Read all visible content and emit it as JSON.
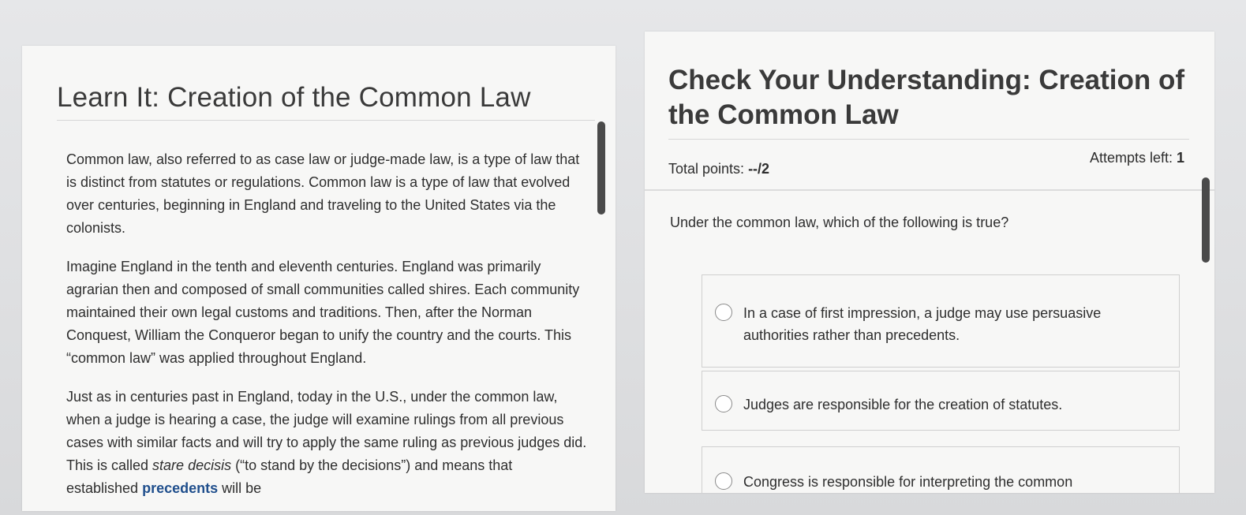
{
  "learn": {
    "title": "Learn It: Creation of the Common Law",
    "p1": "Common law, also referred to as case law or judge-made law, is a type of law that is distinct from statutes or regulations. Common law is a type of law that evolved over centuries, beginning in England and traveling to the United States via the colonists.",
    "p2": "Imagine England in the tenth and eleventh centuries. England was primarily agrarian then and composed of small communities called shires. Each community maintained their own legal customs and traditions. Then, after the Norman Conquest, William the Conqueror began to unify the country and the courts. This “common law” was applied throughout England.",
    "p3_a": "Just as in centuries past in England, today in the U.S., under the common law, when a judge is hearing a case, the judge will examine rulings from all previous cases with similar facts and will try to apply the same ruling as previous judges did. This is called ",
    "p3_em": "stare decisis",
    "p3_b": " (“to stand by the decisions”) and means that established ",
    "p3_kw": "precedents",
    "p3_c": " will be"
  },
  "check": {
    "title": "Check Your Understanding: Creation of the Common Law",
    "points_label": "Total points: ",
    "points_value": "--/2",
    "attempts_label": "Attempts left: ",
    "attempts_value": "1",
    "question": "Under the common law, which of the following is true?",
    "options": [
      "In a case of first impression, a judge may use persuasive authorities rather than precedents.",
      "Judges are responsible for the creation of statutes.",
      "Congress is responsible for interpreting the common"
    ]
  }
}
